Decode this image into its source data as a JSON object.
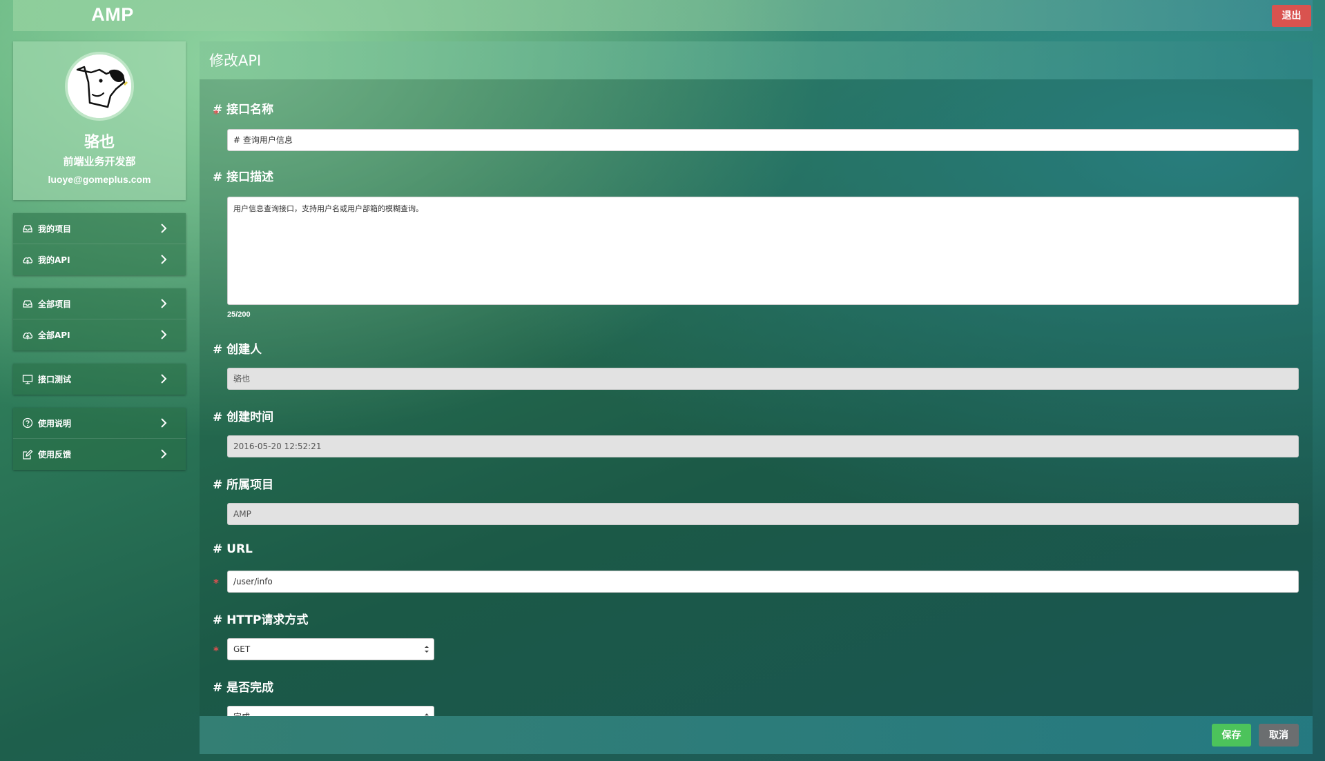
{
  "app": {
    "logo": "AMP",
    "logout_label": "退出"
  },
  "profile": {
    "name": "骆也",
    "department": "前端业务开发部",
    "email": "luoye@gomeplus.com"
  },
  "sidebar": {
    "groups": [
      {
        "items": [
          {
            "label": "我的项目",
            "icon": "inbox-icon"
          },
          {
            "label": "我的API",
            "icon": "cloud-icon"
          }
        ]
      },
      {
        "items": [
          {
            "label": "全部项目",
            "icon": "inbox-icon"
          },
          {
            "label": "全部API",
            "icon": "cloud-icon"
          }
        ]
      },
      {
        "items": [
          {
            "label": "接口测试",
            "icon": "monitor-icon"
          }
        ]
      },
      {
        "items": [
          {
            "label": "使用说明",
            "icon": "help-icon"
          },
          {
            "label": "使用反馈",
            "icon": "edit-icon"
          }
        ]
      }
    ]
  },
  "main": {
    "title": "修改API",
    "fields": {
      "name": {
        "label": "# 接口名称",
        "value": "# 查询用户信息",
        "required": "*"
      },
      "description": {
        "label": "# 接口描述",
        "value": "用户信息查询接口，支持用户名或用户部箱的模糊查询。",
        "counter": "25/200"
      },
      "creator": {
        "label": "# 创建人",
        "value": "骆也"
      },
      "created_at": {
        "label": "# 创建时间",
        "value": "2016-05-20 12:52:21"
      },
      "project": {
        "label": "# 所属项目",
        "value": "AMP"
      },
      "url": {
        "label": "# URL",
        "value": "/user/info",
        "required": "*"
      },
      "method": {
        "label": "# HTTP请求方式",
        "value": "GET",
        "required": "*"
      },
      "done": {
        "label": "# 是否完成",
        "value": "完成"
      }
    },
    "save_label": "保存",
    "cancel_label": "取消"
  },
  "colors": {
    "logout": "#d9534f",
    "save": "#4cc35b",
    "cancel": "#6b6e70",
    "required": "#e05050"
  }
}
